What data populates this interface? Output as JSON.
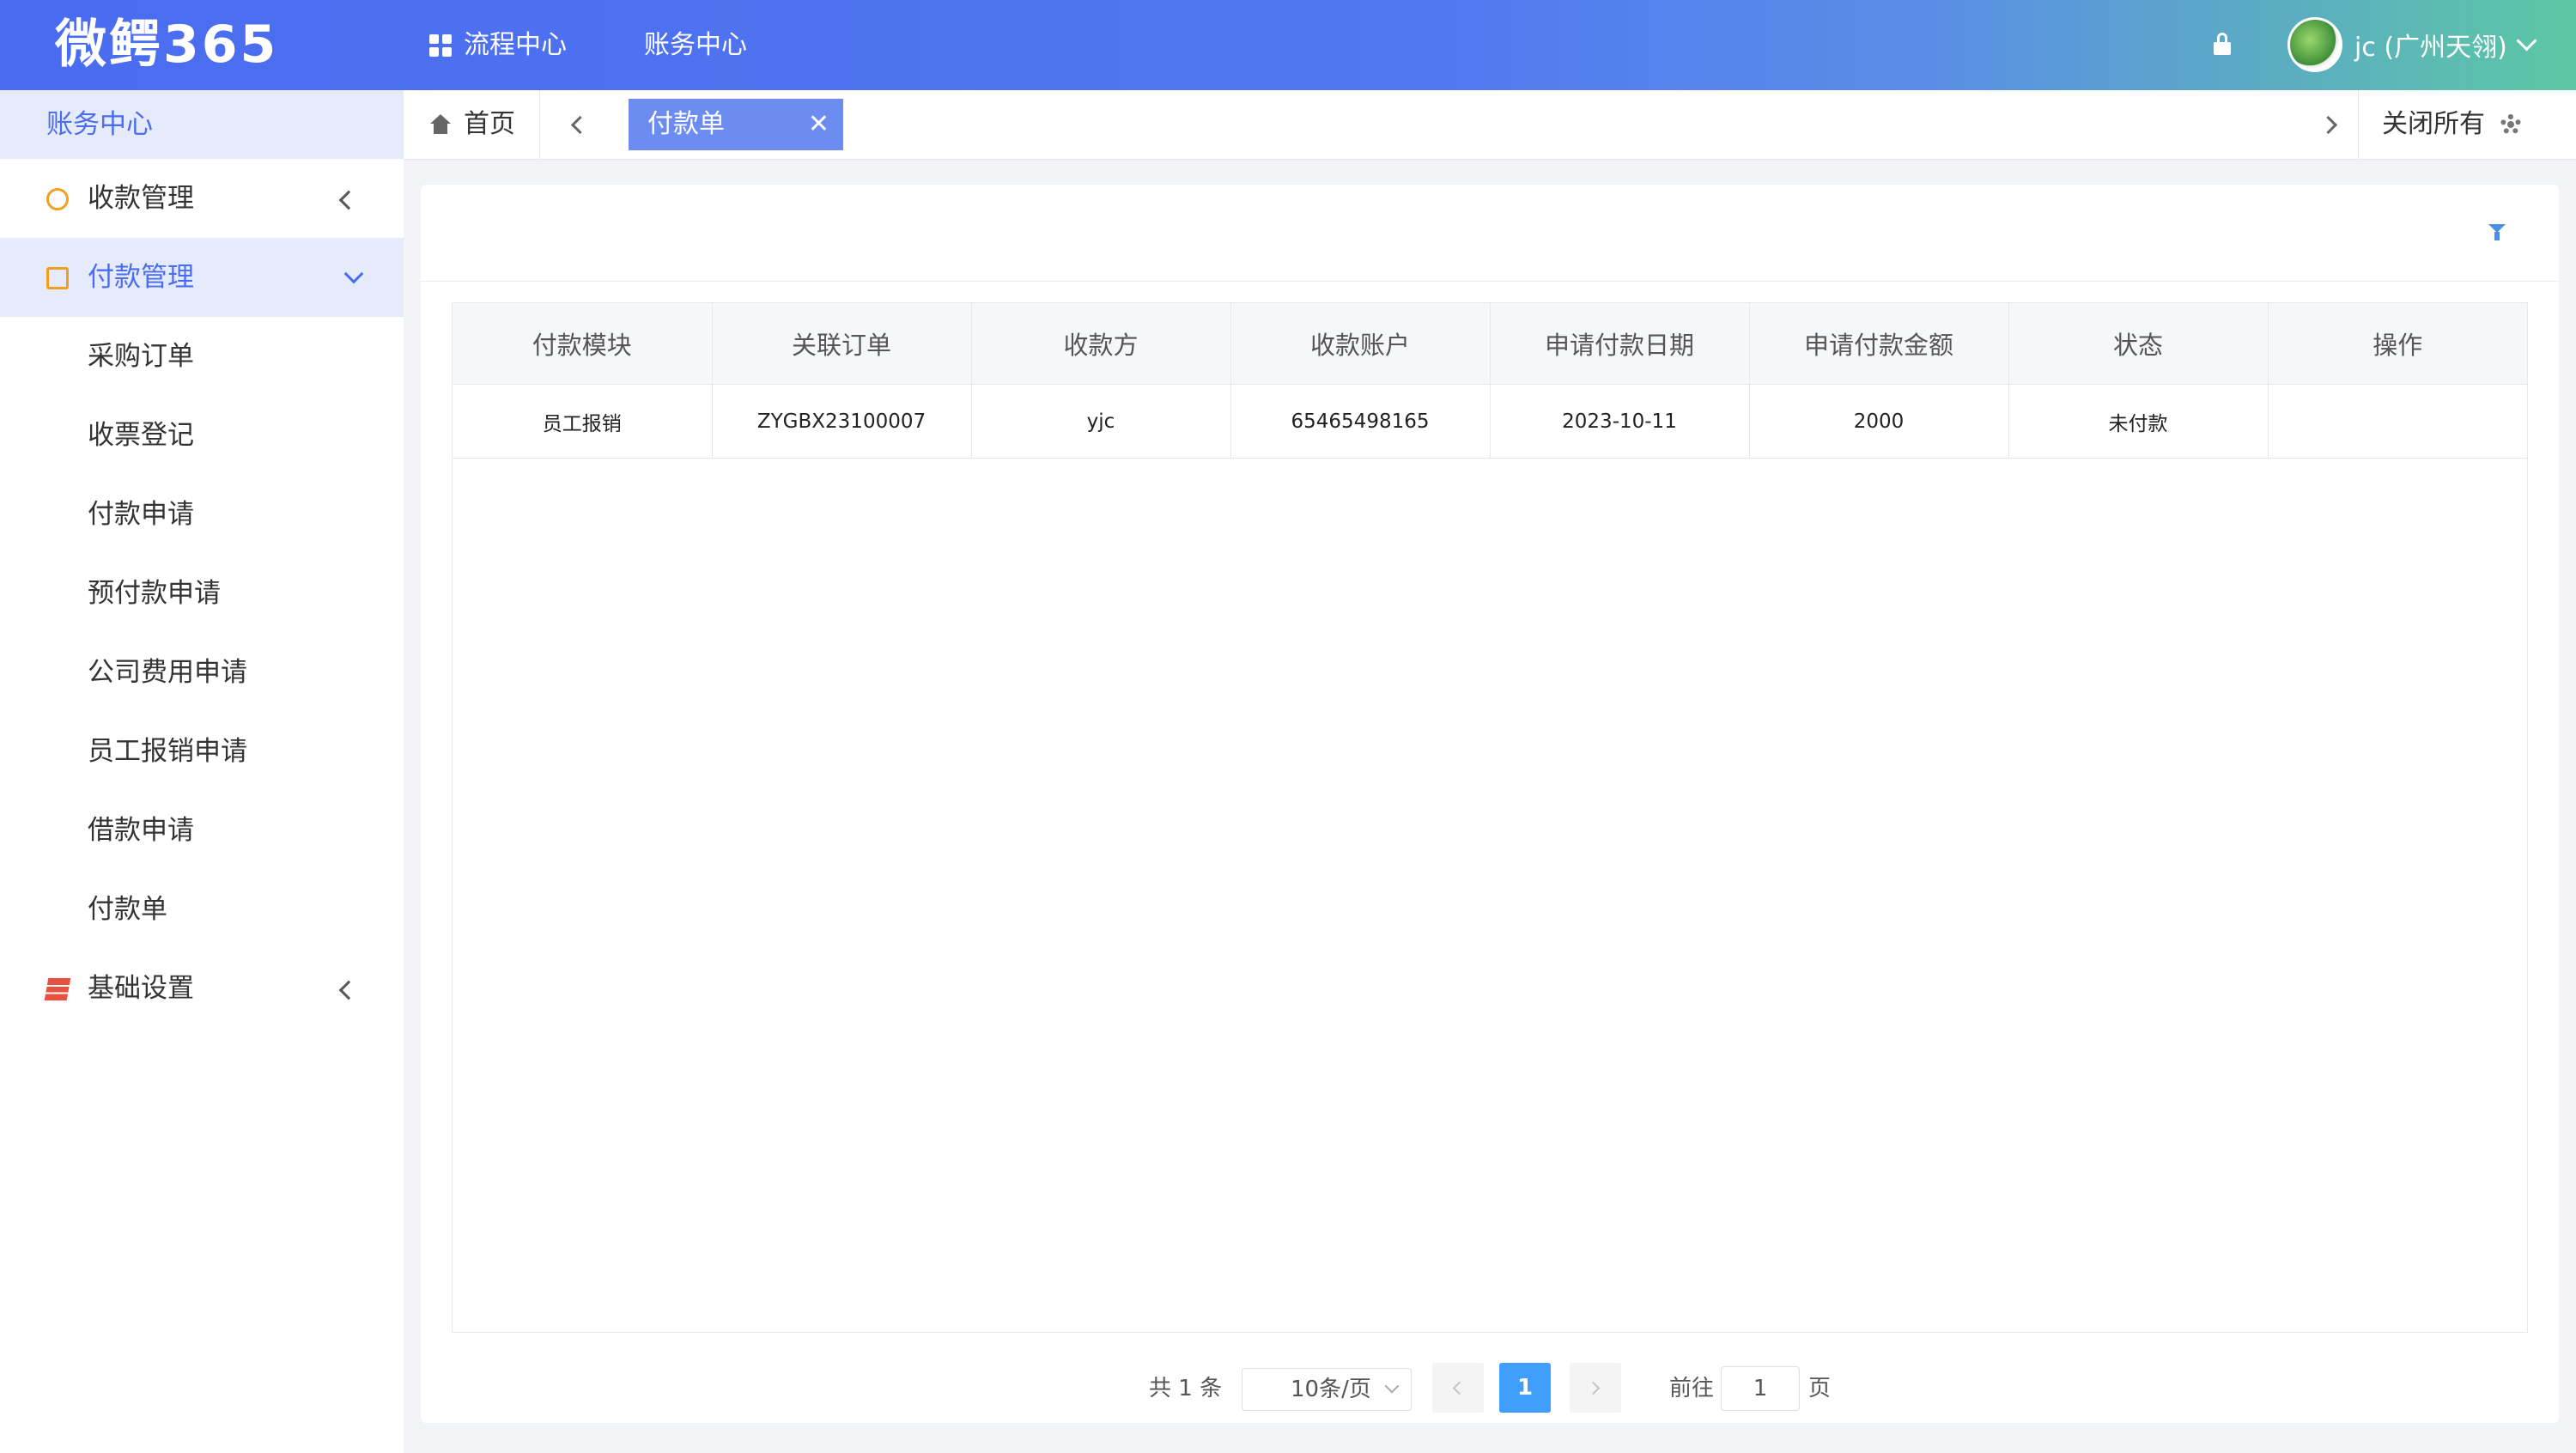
{
  "header": {
    "logo": "微鳄365",
    "nav": [
      "流程中心",
      "账务中心"
    ],
    "user_name": "jc (广州天翎)"
  },
  "sidebar": {
    "title": "账务中心",
    "menu": [
      {
        "label": "收款管理",
        "icon": "clock-icon",
        "expanded": false
      },
      {
        "label": "付款管理",
        "icon": "clipboard-icon",
        "expanded": true,
        "children": [
          "采购订单",
          "收票登记",
          "付款申请",
          "预付款申请",
          "公司费用申请",
          "员工报销申请",
          "借款申请",
          "付款单"
        ]
      },
      {
        "label": "基础设置",
        "icon": "layers-icon",
        "expanded": false
      }
    ]
  },
  "tabs": {
    "home": "首页",
    "active": "付款单",
    "close_all": "关闭所有"
  },
  "table": {
    "columns": [
      "付款模块",
      "关联订单",
      "收款方",
      "收款账户",
      "申请付款日期",
      "申请付款金额",
      "状态",
      "操作"
    ],
    "rows": [
      [
        "员工报销",
        "ZYGBX23100007",
        "yjc",
        "65465498165",
        "2023-10-11",
        "2000",
        "未付款",
        ""
      ]
    ]
  },
  "pagination": {
    "total": "共 1 条",
    "page_size": "10条/页",
    "current_page": "1",
    "goto_label": "前往",
    "goto_value": "1",
    "goto_suffix": "页"
  },
  "colors": {
    "accent": "#4a6cf0",
    "pager_active": "#409eff"
  }
}
